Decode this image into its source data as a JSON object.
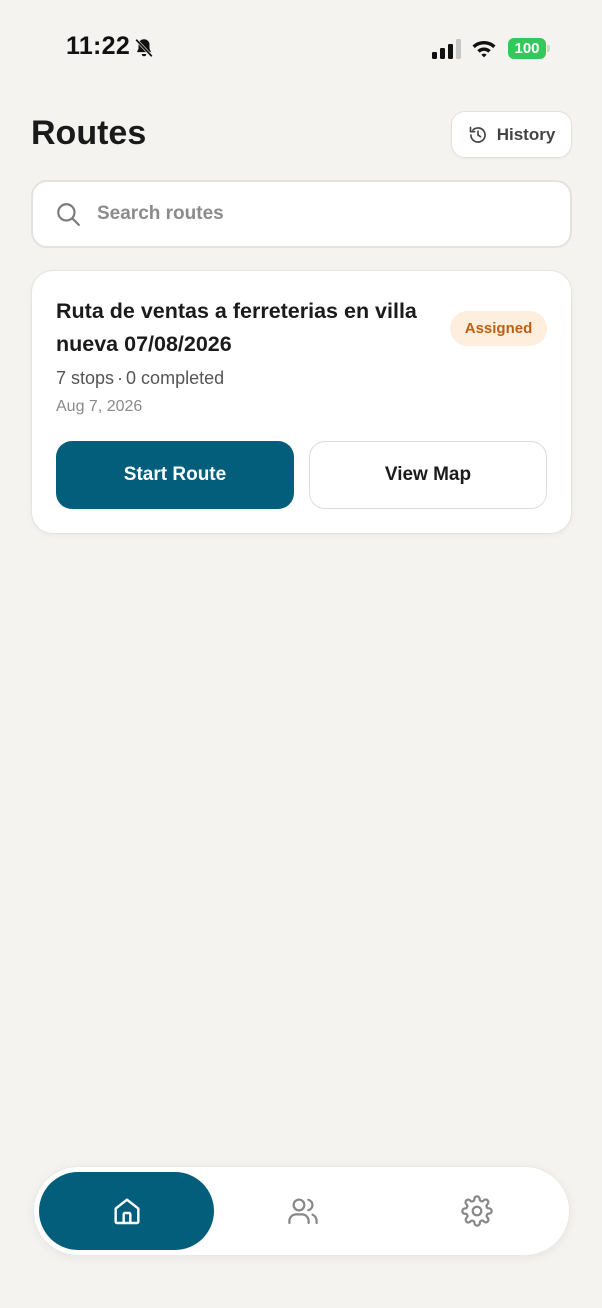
{
  "status_bar": {
    "time": "11:22",
    "battery": "100",
    "icons": [
      "bell-slash-icon",
      "cellular-signal-icon",
      "wifi-icon",
      "battery-icon"
    ]
  },
  "header": {
    "title": "Routes",
    "history_label": "History",
    "history_icon": "history-clock-icon"
  },
  "search": {
    "placeholder": "Search routes",
    "value": "",
    "icon": "search-icon"
  },
  "routes": [
    {
      "title": "Ruta de ventas a ferreterias en villa nueva 07/08/2026",
      "status": "Assigned",
      "stops": "7 stops",
      "separator": "·",
      "completed": "0 completed",
      "date": "Aug 7, 2026",
      "primary_action": "Start Route",
      "secondary_action": "View Map"
    }
  ],
  "bottom_nav": {
    "items": [
      {
        "icon": "home-icon",
        "active": true
      },
      {
        "icon": "users-icon",
        "active": false
      },
      {
        "icon": "settings-gear-icon",
        "active": false
      }
    ]
  },
  "colors": {
    "background": "#f4f3f0",
    "primary": "#035e7b",
    "badge_bg": "#fdeede",
    "badge_text": "#bf5f10",
    "battery": "#34c759"
  }
}
